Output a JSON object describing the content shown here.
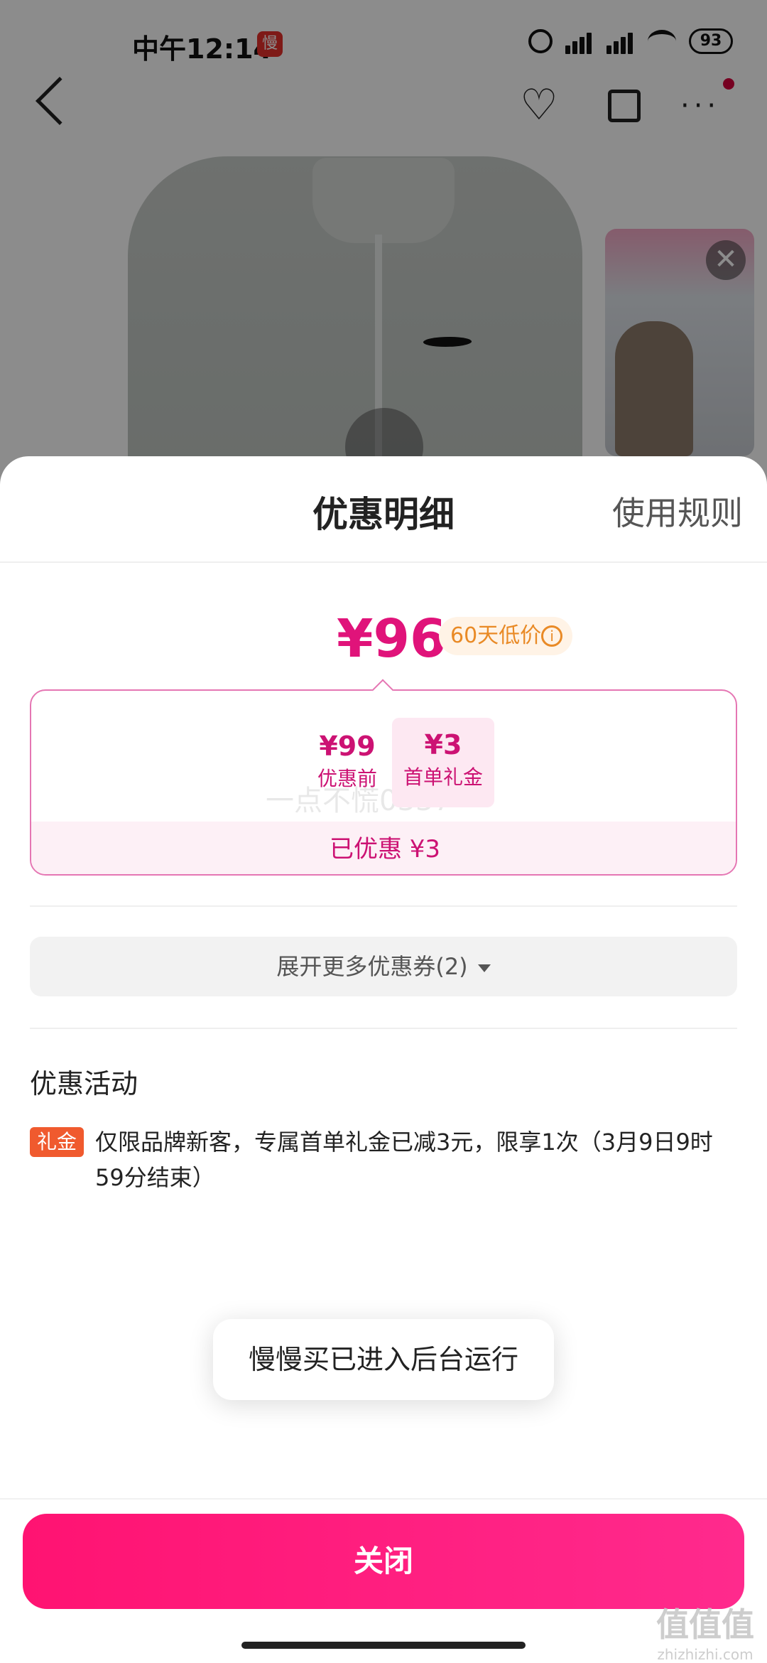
{
  "status_bar": {
    "time": "中午12:14",
    "app_badge": "慢",
    "battery": "93"
  },
  "nav": {
    "fav_glyph": "♡",
    "more_glyph": "···"
  },
  "live_card": {
    "close_glyph": "✕"
  },
  "sheet": {
    "title": "优惠明细",
    "rules_link": "使用规则",
    "final_price": "¥96",
    "price_tag": "60天低价",
    "price_tag_icon": "i",
    "calc": {
      "before_value": "¥99",
      "before_label": "优惠前",
      "minus": "-",
      "coupon_value": "¥3",
      "coupon_label": "首单礼金",
      "watermark": "一点不慌0337",
      "saved": "已优惠 ¥3"
    },
    "expand_button": "展开更多优惠券(2)",
    "activities_title": "优惠活动",
    "activity": {
      "badge": "礼金",
      "text": "仅限品牌新客，专属首单礼金已减3元，限享1次（3月9日9时59分结束）"
    }
  },
  "toast": "慢慢买已进入后台运行",
  "close_button": "关闭",
  "watermark": {
    "big": "值值值",
    "small": "zhizhizhi.com"
  },
  "colors": {
    "accent": "#e0137a",
    "button": "#ff1372",
    "badge": "#f05a2e"
  }
}
